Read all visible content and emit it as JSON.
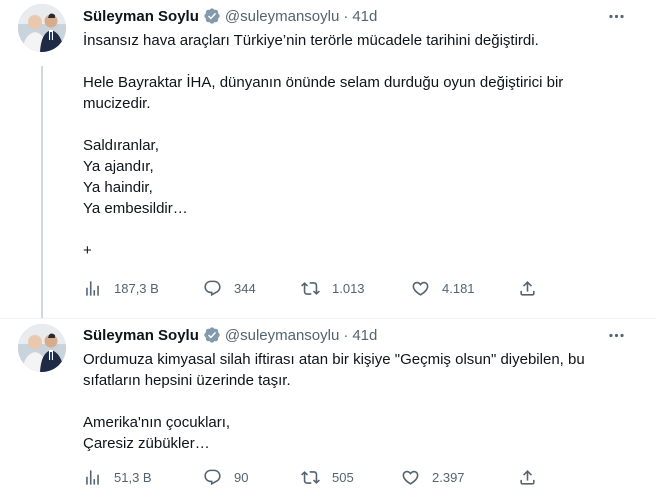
{
  "tweets": [
    {
      "name": "Süleyman Soylu",
      "handle": "@suleymansoylu",
      "dot": "·",
      "time": "41d",
      "lines": [
        "İnsansız hava araçları Türkiye’nin terörle mücadele tarihini değiştirdi.",
        "",
        "Hele Bayraktar İHA, dünyanın önünde selam durduğu oyun değiştirici bir",
        "mucizedir.",
        "",
        "Saldıranlar,",
        "Ya ajandır,",
        "Ya haindir,",
        "Ya embesildir…",
        "",
        "+"
      ],
      "views": "187,3 B",
      "replies": "344",
      "retweets": "1.013",
      "likes": "4.181"
    },
    {
      "name": "Süleyman Soylu",
      "handle": "@suleymansoylu",
      "dot": "·",
      "time": "41d",
      "lines": [
        "Ordumuza kimyasal silah iftirası atan bir kişiye \"Geçmiş olsun\" diyebilen, bu",
        "sıfatların hepsini üzerinde taşır.",
        "",
        "Amerika'nın çocukları,",
        "Çaresiz zübükler…"
      ],
      "views": "51,3 B",
      "replies": "90",
      "retweets": "505",
      "likes": "2.397"
    }
  ],
  "icons": {
    "verified": "verified-badge-icon",
    "more": "more-dots-icon",
    "views": "analytics-icon",
    "reply": "reply-icon",
    "retweet": "retweet-icon",
    "like": "heart-icon",
    "share": "share-icon"
  },
  "colors": {
    "text": "#0f1419",
    "secondary": "#536471",
    "divider": "#eff3f4",
    "thread_line": "#cfd9de",
    "verified": "#829aab"
  }
}
